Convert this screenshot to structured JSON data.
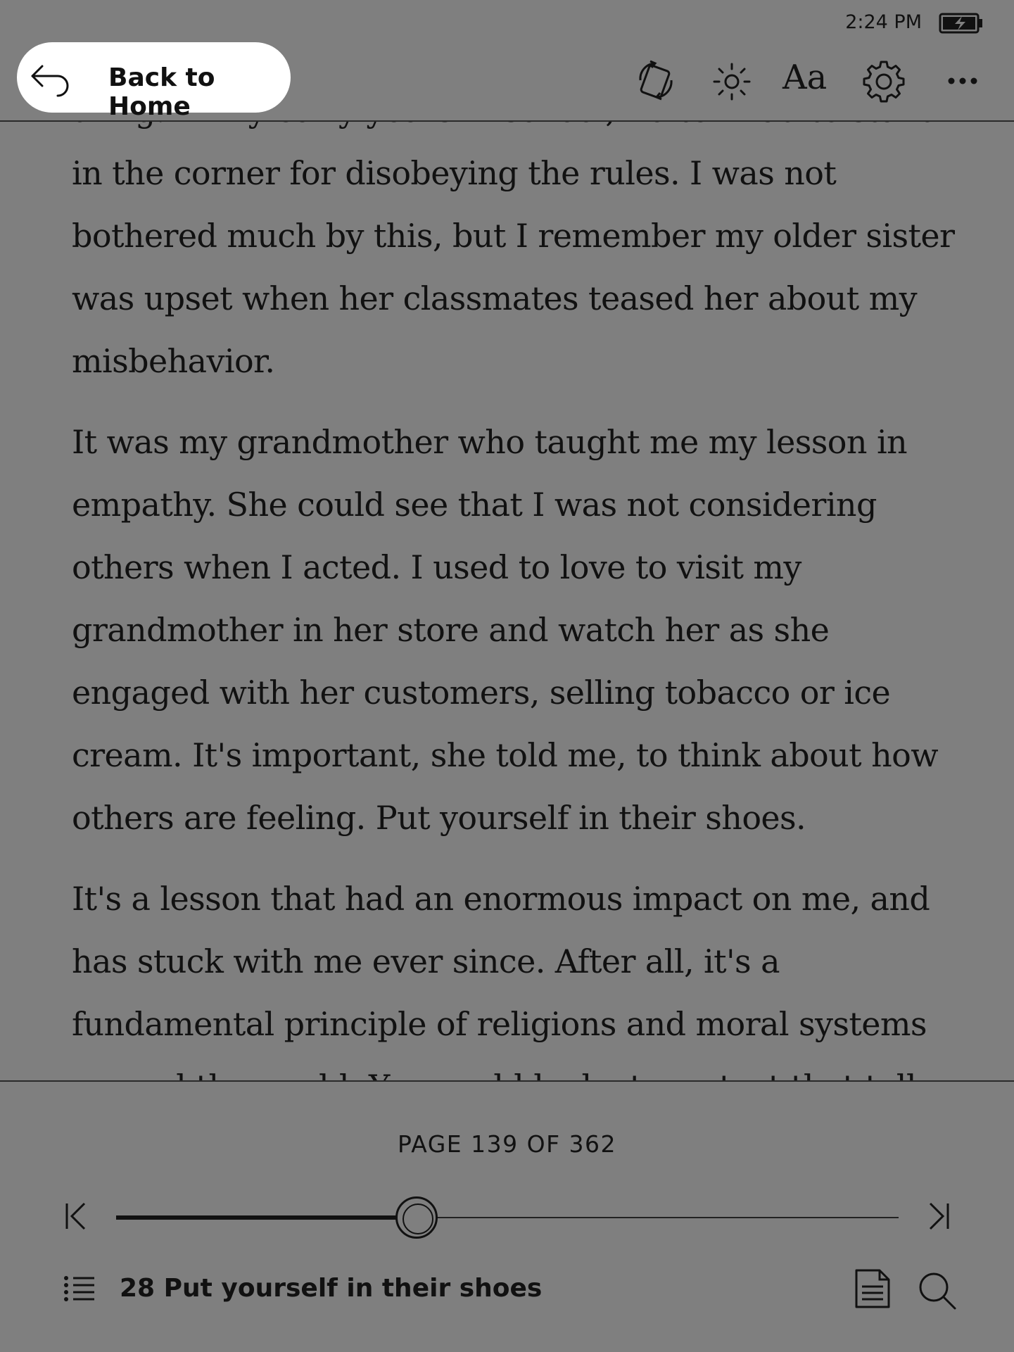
{
  "status_bar": {
    "time": "2:24 PM",
    "battery_icon": "battery-charging-icon"
  },
  "toolbar": {
    "back_label": "Back to Home",
    "back_icon": "back-arrow-icon",
    "rotate_icon": "screen-rotate-icon",
    "brightness_icon": "brightness-icon",
    "font_label": "Aa",
    "settings_icon": "gear-icon",
    "more_icon": "more-dots-icon"
  },
  "content": {
    "paragraphs": [
      {
        "lines": [
          "thing. In my early years in school, I often had to stand",
          "in the corner for disobeying the rules. I was not",
          "bothered much by this, but I remember my older sister",
          "was upset when her classmates teased her about my",
          "misbehavior."
        ]
      },
      {
        "lines": [
          "It was my grandmother who taught me my lesson in",
          "empathy. She could see that I was not considering",
          "others when I acted. I used to love to visit my",
          "grandmother in her store and watch her as she",
          "engaged with her customers, selling tobacco or ice",
          "cream. It's important, she told me, to think about how",
          "others are feeling. Put yourself in their shoes."
        ]
      },
      {
        "lines": [
          "It's a lesson that had an enormous impact on me, and",
          "has stuck with me ever since. After all, it's a",
          "fundamental principle of religions and moral systems",
          "around the world. You could look at any text that tells"
        ]
      }
    ]
  },
  "footer": {
    "page_label": "PAGE 139 OF 362",
    "current_page": 139,
    "total_pages": 362,
    "progress_fraction": 0.384,
    "first_page_icon": "skip-to-start-icon",
    "last_page_icon": "skip-to-end-icon",
    "toc_icon": "table-of-contents-icon",
    "chapter_title": "28 Put yourself in their shoes",
    "notes_icon": "notes-page-icon",
    "search_icon": "search-icon"
  }
}
